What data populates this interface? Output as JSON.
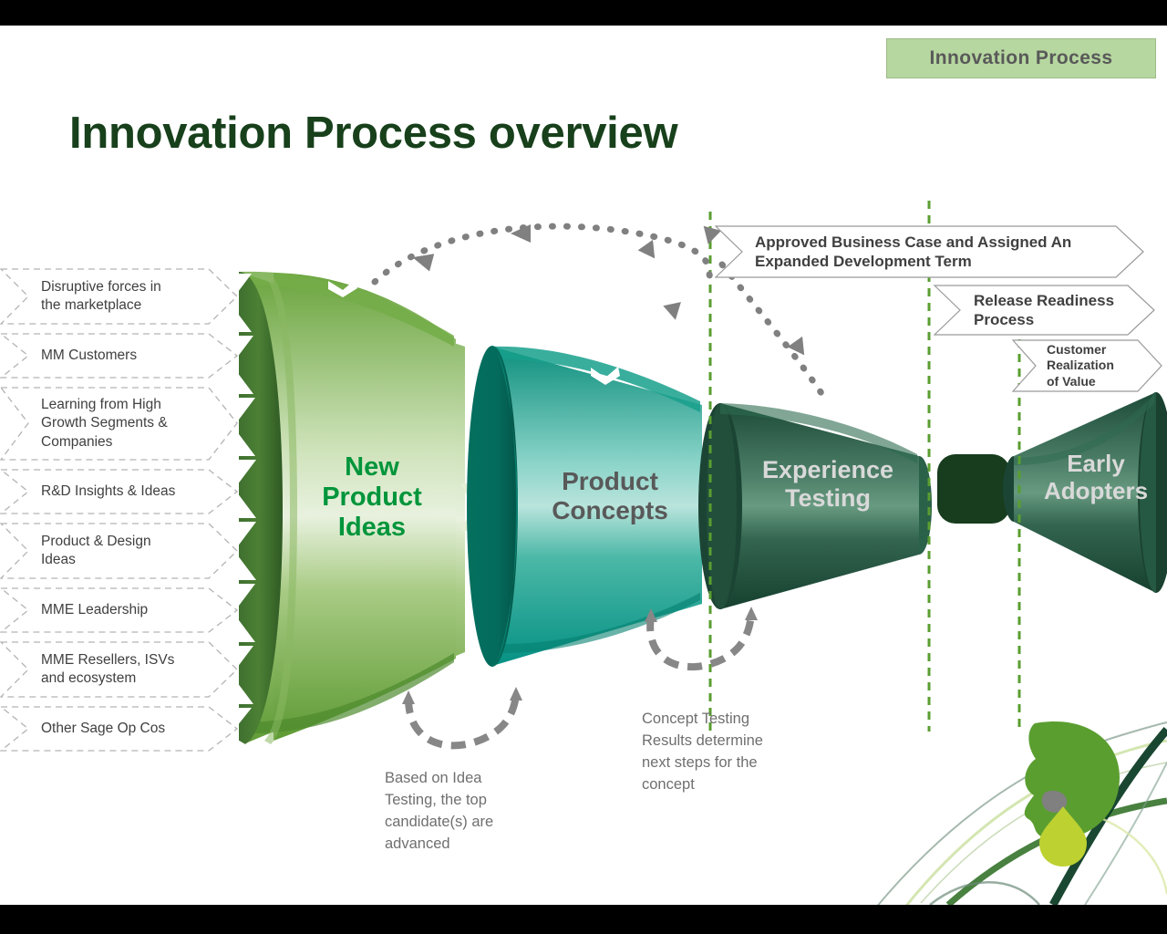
{
  "slide": {
    "title": "Innovation Process overview",
    "header_tag": "Innovation Process",
    "title_color": "#17401b",
    "header_tag_bg": "#b6d7a0",
    "header_tag_color": "#595959",
    "background": "#ffffff",
    "letterbox_color": "#000000"
  },
  "inputs": {
    "items": [
      {
        "label": "Disruptive forces in\nthe marketplace"
      },
      {
        "label": "MM Customers"
      },
      {
        "label": "Learning from High\nGrowth Segments &\nCompanies"
      },
      {
        "label": "R&D Insights & Ideas"
      },
      {
        "label": "Product &  Design\nIdeas"
      },
      {
        "label": "MME Leadership"
      },
      {
        "label": "MME Resellers, ISVs\nand ecosystem"
      },
      {
        "label": "Other Sage Op Cos"
      }
    ]
  },
  "stages": [
    {
      "name": "New\nProduct\nIdeas",
      "color": "#00953b",
      "shape": "funnel",
      "fill": "#6ba43a"
    },
    {
      "name": "Product\nConcepts",
      "color": "#595959",
      "shape": "funnel",
      "fill": "#0c9a85"
    },
    {
      "name": "Experience\nTesting",
      "color": "#d9d9d9",
      "shape": "cone",
      "fill": "#1f5540"
    },
    {
      "name": "Early\nAdopters",
      "color": "#d9d9d9",
      "shape": "cone-reverse",
      "fill": "#1f5540"
    }
  ],
  "gate_banners": [
    {
      "label": "Approved Business Case and Assigned An\nExpanded Development Term",
      "font_size": "17px"
    },
    {
      "label": "Release Readiness\nProcess",
      "font_size": "17px"
    },
    {
      "label": "Customer\nRealization\nof Value",
      "font_size": "14px"
    }
  ],
  "captions": [
    {
      "text": "Based on Idea\nTesting, the top\ncandidate(s) are\nadvanced"
    },
    {
      "text": "Concept Testing\nResults determine\nnext steps for the\nconcept"
    }
  ],
  "gate_lines": {
    "color": "#5a9e30",
    "count": 3
  },
  "feedback_arrows": {
    "style": "dotted",
    "color": "#808080",
    "count": 2
  }
}
